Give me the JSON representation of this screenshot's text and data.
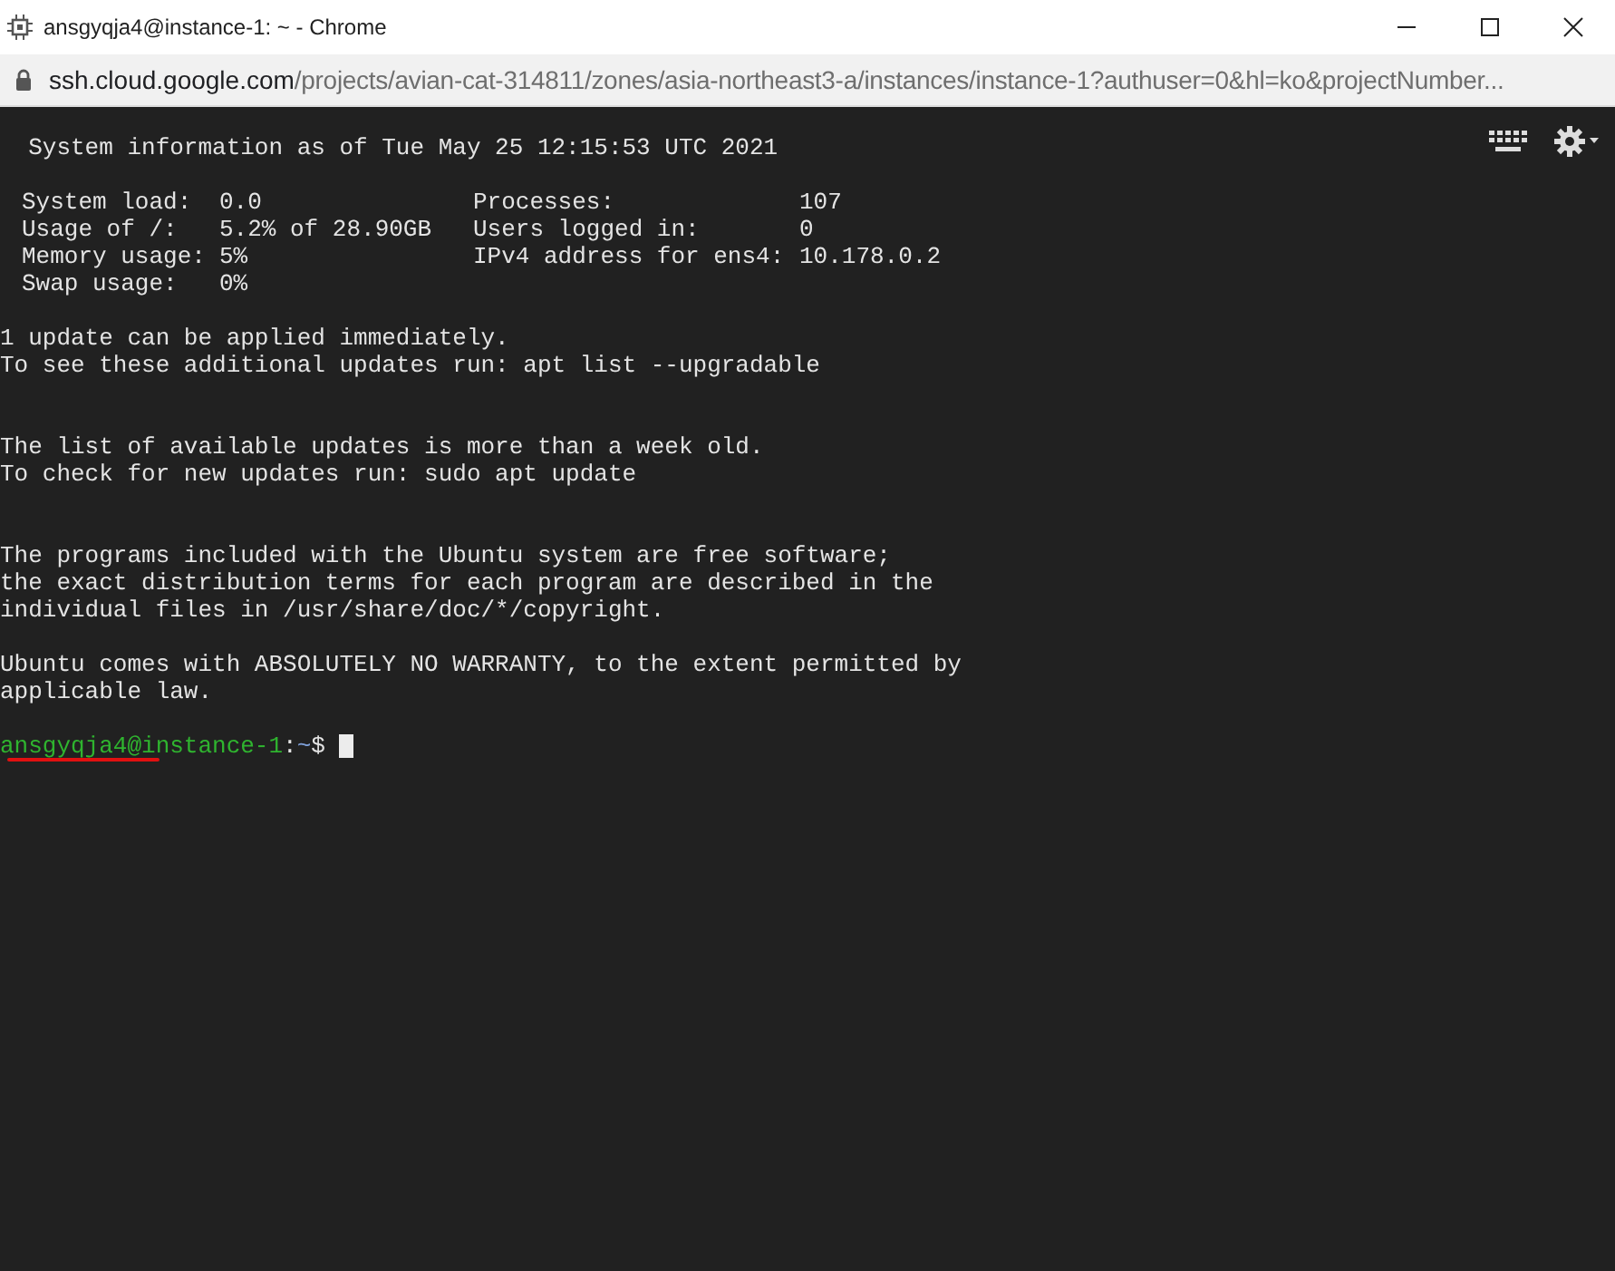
{
  "window": {
    "title": "ansgyqja4@instance-1: ~ - Chrome"
  },
  "address_bar": {
    "host": "ssh.cloud.google.com",
    "path": "/projects/avian-cat-314811/zones/asia-northeast3-a/instances/instance-1?authuser=0&hl=ko&projectNumber..."
  },
  "terminal": {
    "lines": [
      {
        "kind": "text",
        "text": "  System information as of Tue May 25 12:15:53 UTC 2021"
      },
      {
        "kind": "blank"
      },
      {
        "kind": "sysinfo",
        "cells": [
          "System load:",
          "0.0",
          "Processes:",
          "107"
        ]
      },
      {
        "kind": "sysinfo",
        "cells": [
          "Usage of /:",
          "5.2% of 28.90GB",
          "Users logged in:",
          "0"
        ]
      },
      {
        "kind": "sysinfo",
        "cells": [
          "Memory usage:",
          "5%",
          "IPv4 address for ens4:",
          "10.178.0.2"
        ]
      },
      {
        "kind": "sysinfo",
        "cells": [
          "Swap usage:",
          "0%"
        ]
      },
      {
        "kind": "blank"
      },
      {
        "kind": "text",
        "text": "1 update can be applied immediately."
      },
      {
        "kind": "text",
        "text": "To see these additional updates run: apt list --upgradable"
      },
      {
        "kind": "blank"
      },
      {
        "kind": "blank"
      },
      {
        "kind": "text",
        "text": "The list of available updates is more than a week old."
      },
      {
        "kind": "text",
        "text": "To check for new updates run: sudo apt update"
      },
      {
        "kind": "blank"
      },
      {
        "kind": "blank"
      },
      {
        "kind": "text",
        "text": "The programs included with the Ubuntu system are free software;"
      },
      {
        "kind": "text",
        "text": "the exact distribution terms for each program are described in the"
      },
      {
        "kind": "text",
        "text": "individual files in /usr/share/doc/*/copyright."
      },
      {
        "kind": "blank"
      },
      {
        "kind": "text",
        "text": "Ubuntu comes with ABSOLUTELY NO WARRANTY, to the extent permitted by"
      },
      {
        "kind": "text",
        "text": "applicable law."
      },
      {
        "kind": "blank"
      },
      {
        "kind": "prompt",
        "user_host": "ansgyqja4@instance-1",
        "colon": ":",
        "dir": "~",
        "symbol": "$",
        "underlined": true
      }
    ]
  }
}
